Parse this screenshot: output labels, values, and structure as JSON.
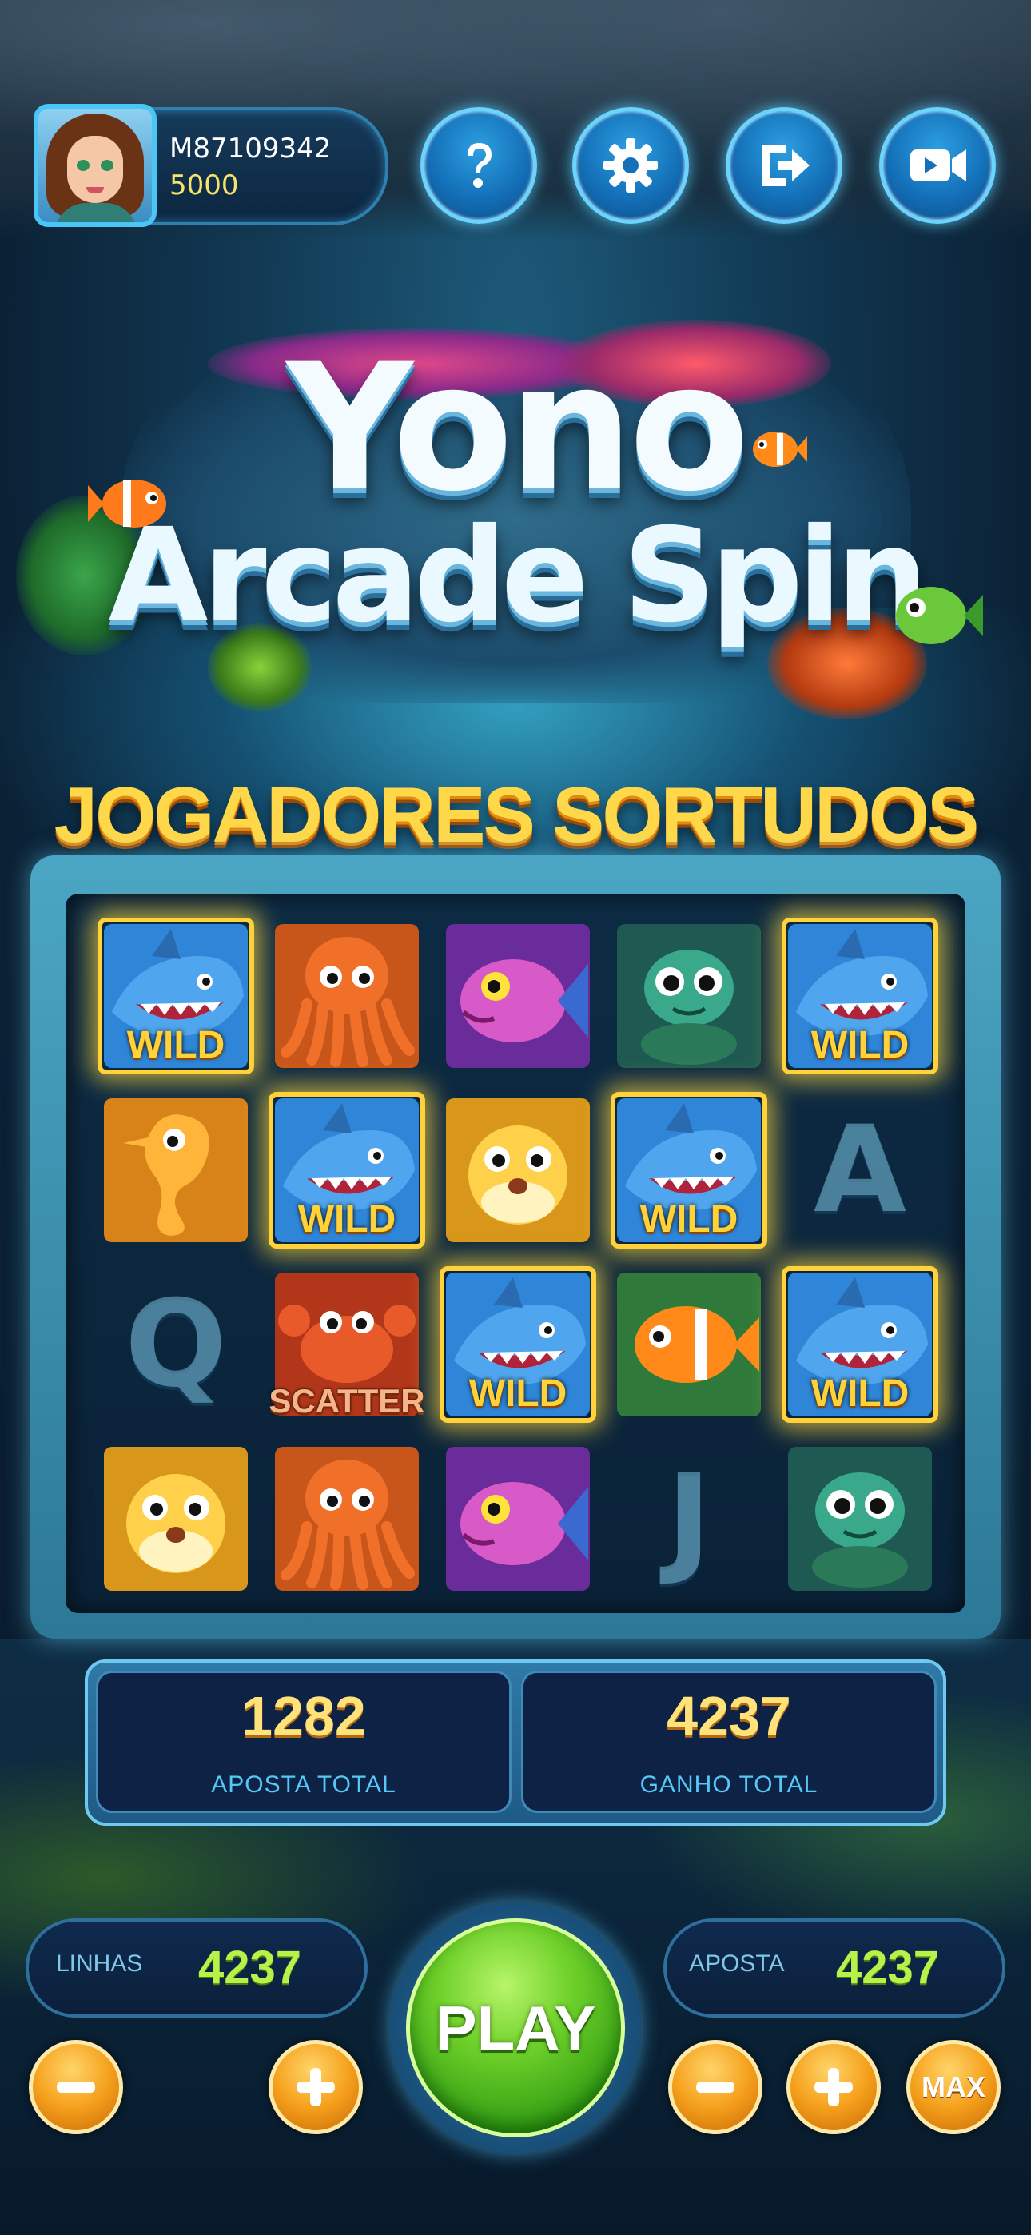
{
  "player": {
    "id": "M87109342",
    "coins": "5000"
  },
  "header_buttons": [
    {
      "icon": "help-icon"
    },
    {
      "icon": "gear-icon"
    },
    {
      "icon": "exit-icon"
    },
    {
      "icon": "video-icon"
    }
  ],
  "logo": {
    "line1": "Yono",
    "line2": "Arcade Spin"
  },
  "banner": "JOGADORES SORTUDOS",
  "reels": {
    "grid": [
      [
        "shark-wild",
        "octopus",
        "purple-fish",
        "turtle",
        "shark-wild"
      ],
      [
        "seahorse",
        "shark-wild",
        "pufferfish",
        "shark-wild",
        "letter-a"
      ],
      [
        "letter-q",
        "crab-scatter",
        "shark-wild",
        "clownfish",
        "shark-wild"
      ],
      [
        "pufferfish",
        "octopus",
        "purple-fish",
        "letter-j",
        "turtle"
      ]
    ],
    "wild_label": "WILD",
    "scatter_label": "SCATTER",
    "letters": {
      "a": "A",
      "q": "Q",
      "j": "J"
    }
  },
  "totals": {
    "bet_value": "1282",
    "bet_label": "APOSTA TOTAL",
    "win_value": "4237",
    "win_label": "GANHO TOTAL"
  },
  "controls": {
    "lines_label": "LINHAS",
    "lines_value": "4237",
    "bet_label": "APOSTA",
    "bet_value": "4237",
    "play_label": "PLAY",
    "max_label": "MAX"
  },
  "colors": {
    "gold": "#ffd23a",
    "stat_green": "#b6f24a",
    "play_green": "#6fd12a",
    "accent_blue": "#56c8f5"
  }
}
